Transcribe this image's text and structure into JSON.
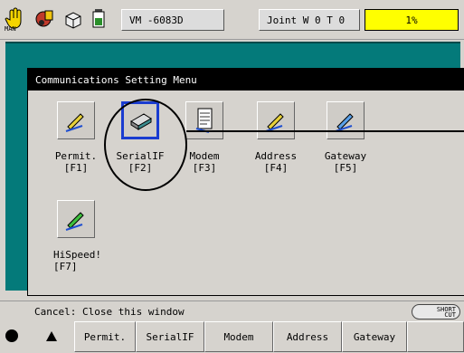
{
  "toolbar": {
    "mode_label": "MAN",
    "program_name": "VM  -6083D",
    "coord_label": "Joint  W 0 T 0",
    "speed_value": "1%"
  },
  "dialog": {
    "title": "Communications Setting Menu",
    "items": [
      {
        "label": "Permit.",
        "key": "[F1]",
        "icon": "pencil-icon"
      },
      {
        "label": "SerialIF",
        "key": "[F2]",
        "icon": "serial-port-icon"
      },
      {
        "label": "Modem",
        "key": "[F3]",
        "icon": "document-icon"
      },
      {
        "label": "Address",
        "key": "[F4]",
        "icon": "pencil-icon"
      },
      {
        "label": "Gateway",
        "key": "[F5]",
        "icon": "pencil-icon"
      },
      {
        "label": "HiSpeed!",
        "key": "[F7]",
        "icon": "pencil-icon"
      }
    ]
  },
  "status": {
    "text": "Cancel: Close this window",
    "shortcut_line1": "SHORT",
    "shortcut_line2": "CUT"
  },
  "bottom": {
    "buttons": [
      "Permit.",
      "SerialIF",
      "Modem",
      "Address",
      "Gateway"
    ]
  },
  "colors": {
    "workarea": "#047a7a",
    "selection_blue": "#1a3cd0",
    "speed_yellow": "#ffff00"
  }
}
